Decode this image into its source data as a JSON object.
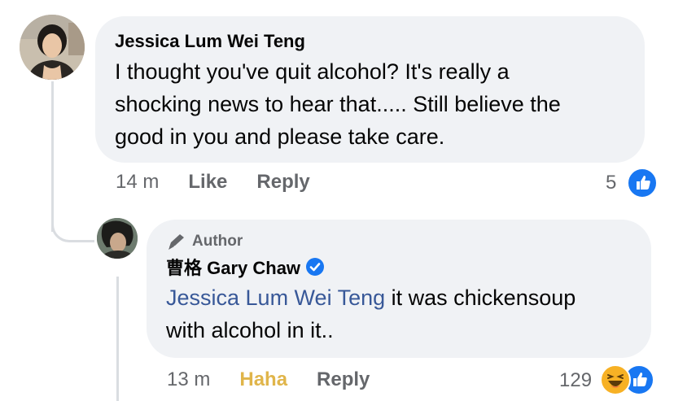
{
  "comment": {
    "author": "Jessica Lum Wei Teng",
    "lines": [
      "I thought you've quit alcohol? It's really a",
      "shocking news to hear that..... Still believe the",
      "good in you and please take care."
    ],
    "time": "14 m",
    "like_label": "Like",
    "reply_label": "Reply",
    "reaction_count": "5",
    "reaction_icons": [
      "like-icon"
    ]
  },
  "reply": {
    "badge_icon": "pen-icon",
    "badge_label": "Author",
    "author": "曹格 Gary Chaw",
    "verified_icon": "verified-badge-icon",
    "mention": "Jessica Lum Wei Teng",
    "text_after_mention": " it was chickensoup",
    "text_line2": "with alcohol in it..",
    "time": "13 m",
    "reaction_label": "Haha",
    "reply_label": "Reply",
    "reaction_count": "129",
    "reaction_icons": [
      "haha-icon",
      "like-icon"
    ]
  },
  "colors": {
    "bubble": "#f0f2f5",
    "secondary_text": "#65676b",
    "mention": "#385898",
    "like_blue": "#1877f2",
    "haha_yellow": "#f7b125"
  }
}
